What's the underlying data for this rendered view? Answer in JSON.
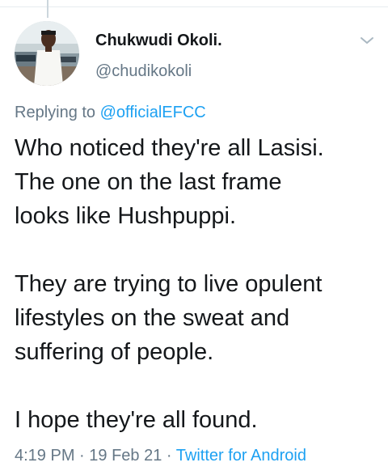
{
  "tweet": {
    "display_name": "Chukwudi Okoli.",
    "handle": "@chudikokoli",
    "avatar_icon": "profile-photo",
    "menu_icon": "chevron-down-icon",
    "reply_prefix": "Replying to",
    "reply_to": "@officialEFCC",
    "paragraphs": [
      "Who noticed they're all Lasisi.\nThe one on the last frame\nlooks like Hushpuppi.",
      "They are trying to live opulent\nlifestyles on the sweat and\nsuffering of people.",
      "I hope they're all found."
    ],
    "time": "4:19 PM",
    "separator": "·",
    "date": "19 Feb 21",
    "source": "Twitter for Android"
  },
  "colors": {
    "text": "#14171a",
    "secondary": "#657786",
    "link": "#1da1f2",
    "divider": "#e6ecf0"
  }
}
